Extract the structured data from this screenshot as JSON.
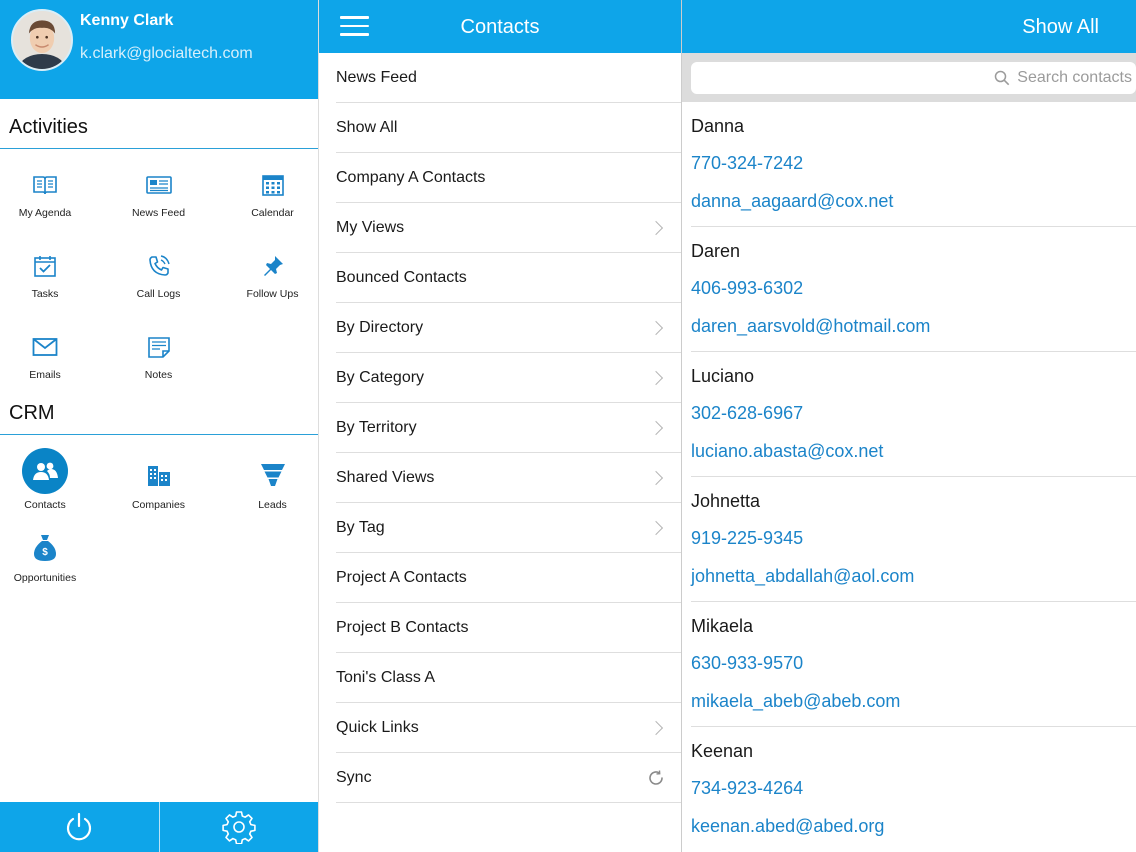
{
  "user": {
    "name": "Kenny Clark",
    "email": "k.clark@glocialtech.com"
  },
  "activities": {
    "title": "Activities",
    "items": [
      {
        "label": "My Agenda",
        "icon": "book-icon"
      },
      {
        "label": "News Feed",
        "icon": "newspaper-icon"
      },
      {
        "label": "Calendar",
        "icon": "calendar-icon"
      },
      {
        "label": "Tasks",
        "icon": "task-calendar-icon"
      },
      {
        "label": "Call Logs",
        "icon": "phone-icon"
      },
      {
        "label": "Follow Ups",
        "icon": "pin-icon"
      },
      {
        "label": "Emails",
        "icon": "envelope-icon"
      },
      {
        "label": "Notes",
        "icon": "notes-icon"
      }
    ]
  },
  "crm": {
    "title": "CRM",
    "items": [
      {
        "label": "Contacts",
        "icon": "people-icon",
        "active": true
      },
      {
        "label": "Companies",
        "icon": "buildings-icon"
      },
      {
        "label": "Leads",
        "icon": "funnel-icon"
      },
      {
        "label": "Opportunities",
        "icon": "money-bag-icon"
      }
    ]
  },
  "bottom_bar": {
    "left_icon": "power-icon",
    "right_icon": "gear-icon"
  },
  "menu": {
    "title": "Contacts",
    "items": [
      {
        "label": "News Feed",
        "chevron": false
      },
      {
        "label": "Show All",
        "chevron": false
      },
      {
        "label": "Company A Contacts",
        "chevron": false
      },
      {
        "label": "My Views",
        "chevron": true
      },
      {
        "label": "Bounced Contacts",
        "chevron": false
      },
      {
        "label": "By Directory",
        "chevron": true
      },
      {
        "label": "By Category",
        "chevron": true
      },
      {
        "label": "By Territory",
        "chevron": true
      },
      {
        "label": "Shared Views",
        "chevron": true
      },
      {
        "label": "By Tag",
        "chevron": true
      },
      {
        "label": "Project A Contacts",
        "chevron": false
      },
      {
        "label": "Project B Contacts",
        "chevron": false
      },
      {
        "label": "Toni's Class A",
        "chevron": false
      },
      {
        "label": "Quick Links",
        "chevron": true
      },
      {
        "label": "Sync",
        "chevron": false,
        "icon": "sync-icon"
      }
    ]
  },
  "contacts_panel": {
    "title": "Show All",
    "search_placeholder": "Search contacts",
    "list": [
      {
        "name": "Danna",
        "phone": "770-324-7242",
        "email": "danna_aagaard@cox.net"
      },
      {
        "name": "Daren",
        "phone": "406-993-6302",
        "email": "daren_aarsvold@hotmail.com"
      },
      {
        "name": "Luciano",
        "phone": "302-628-6967",
        "email": "luciano.abasta@cox.net"
      },
      {
        "name": "Johnetta",
        "phone": "919-225-9345",
        "email": "johnetta_abdallah@aol.com"
      },
      {
        "name": "Mikaela",
        "phone": "630-933-9570",
        "email": "mikaela_abeb@abeb.com"
      },
      {
        "name": "Keenan",
        "phone": "734-923-4264",
        "email": "keenan.abed@abed.org"
      }
    ]
  },
  "colors": {
    "brand": "#0ea5e9",
    "link": "#1b84c9",
    "active_icon": "#0a84c6"
  }
}
